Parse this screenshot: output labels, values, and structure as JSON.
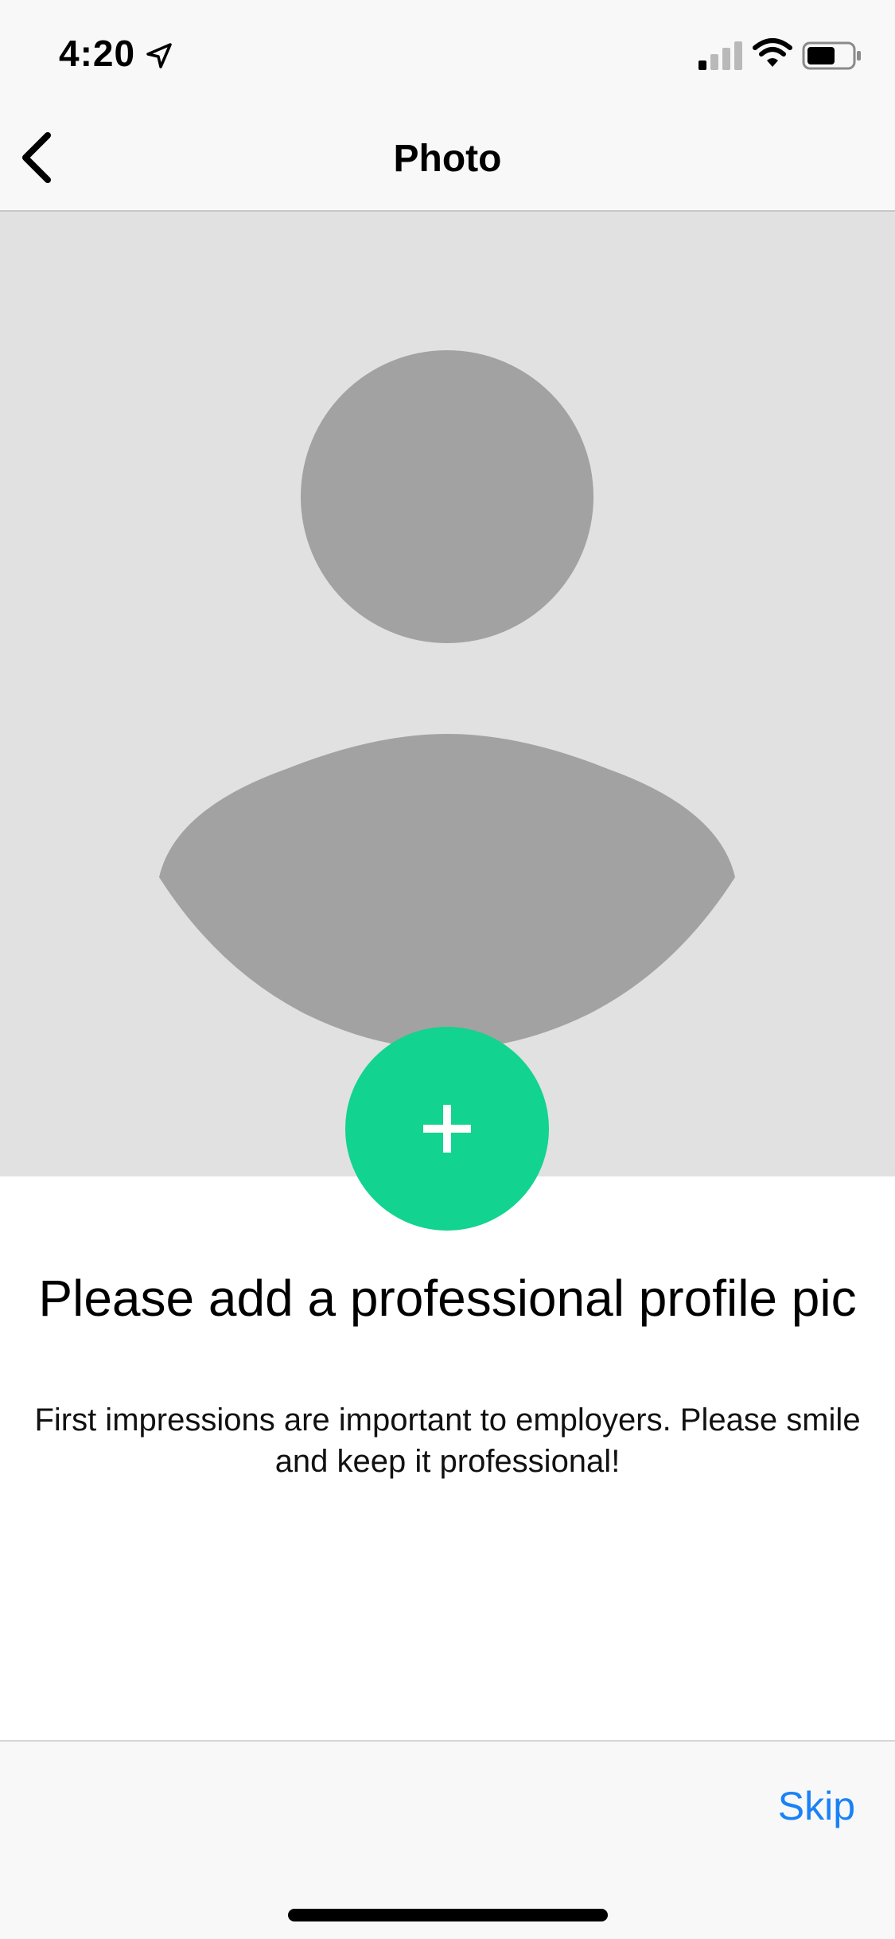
{
  "status_bar": {
    "time": "4:20",
    "icons": [
      "location-arrow-icon",
      "cellular-signal-icon",
      "wifi-icon",
      "battery-icon"
    ]
  },
  "nav": {
    "title": "Photo",
    "back_icon": "chevron-left-icon"
  },
  "photo_placeholder": {
    "icon": "person-silhouette-icon",
    "background_color": "#e1e1e1",
    "silhouette_color": "#a2a2a2"
  },
  "add_button": {
    "icon": "plus-icon",
    "color": "#12d38f"
  },
  "content": {
    "headline": "Please add a professional profile pic",
    "subtext": "First impressions are important to employers. Please smile and keep it professional!"
  },
  "footer": {
    "skip_label": "Skip",
    "skip_color": "#1a82f7"
  }
}
